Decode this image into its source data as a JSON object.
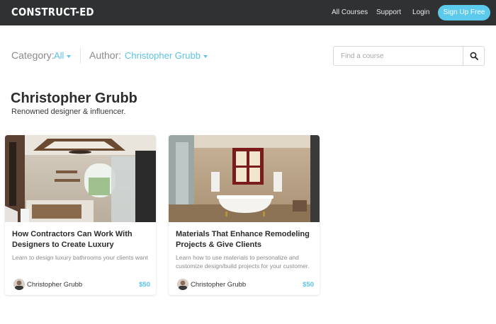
{
  "header": {
    "logo": "CONSTRUCT-ED",
    "nav": {
      "all_courses": "All Courses",
      "support": "Support",
      "login": "Login"
    },
    "signup": "Sign Up Free"
  },
  "filters": {
    "category_label": "Category:",
    "category_value": "All",
    "author_label": "Author:",
    "author_value": "Christopher Grubb"
  },
  "search": {
    "placeholder": "Find a course"
  },
  "author": {
    "name": "Christopher Grubb",
    "bio": "Renowned designer & influencer."
  },
  "courses": [
    {
      "title": "How Contractors Can Work With Designers to Create Luxury",
      "description": "Learn to design luxury bathrooms your clients want",
      "author": "Christopher Grubb",
      "price": "$50"
    },
    {
      "title": "Materials That Enhance Remodeling Projects & Give Clients",
      "description": "Learn how to use materials to personalize and customize design/build projects for your customer.",
      "author": "Christopher Grubb",
      "price": "$50"
    }
  ],
  "colors": {
    "accent": "#5bcaed",
    "nav_bg": "#2f3132"
  }
}
